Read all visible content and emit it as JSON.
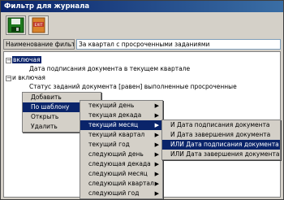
{
  "window": {
    "title": "Фильтр для журнала"
  },
  "toolbar": {
    "save_icon": "floppy-disk-icon",
    "exit_icon": "exit-door-icon",
    "exit_label": "EXIT"
  },
  "filter": {
    "label": "Наименование фильтра",
    "value": "За квартал с просроченными заданиями"
  },
  "tree": {
    "node1": "включая",
    "node1_child": "Дата подписания документа в текущем квартале",
    "node2": "и включая",
    "node2_child": "Статус заданий документа [равен] выполненные просроченные"
  },
  "context_menu": {
    "items": [
      "Добавить",
      "По шаблону",
      "Открыть",
      "Удалить"
    ]
  },
  "template_menu": {
    "items": [
      "текущий день",
      "текущая декада",
      "текущий месяц",
      "текущий квартал",
      "текущий год",
      "следующий день",
      "следующая декада",
      "следующий месяц",
      "следующий квартал",
      "следующий год"
    ]
  },
  "field_menu": {
    "items": [
      "И Дата подписания документа",
      "И Дата завершения документа",
      "ИЛИ Дата подписания документа",
      "ИЛИ Дата завершения документа"
    ]
  },
  "colors": {
    "selection": "#0a246a",
    "window": "#d4d0c8"
  }
}
